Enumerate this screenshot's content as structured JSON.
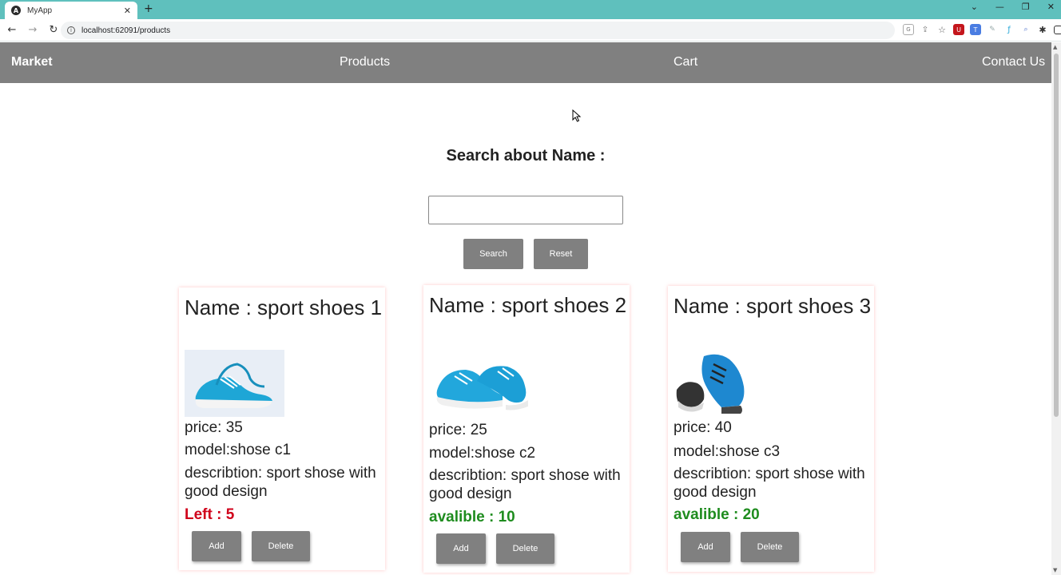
{
  "browser": {
    "tab_title": "MyApp",
    "tab_close": "✕",
    "new_tab": "+",
    "url": "localhost:62091/products",
    "win_controls": [
      "⌄",
      "—",
      "❐",
      "✕"
    ]
  },
  "navbar": {
    "brand": "Market",
    "links": [
      "Products",
      "Cart",
      "Contact Us"
    ]
  },
  "search": {
    "title": "Search about Name :",
    "input_value": "",
    "search_button": "Search",
    "reset_button": "Reset"
  },
  "products": [
    {
      "name": "Name : sport shoes 1",
      "price": "price: 35",
      "model": "model:shose c1",
      "description": "describtion: sport shose with good design",
      "stock": "Left : 5",
      "stock_color": "#d0021b",
      "image_icon": "shoe-image-icon",
      "add_label": "Add",
      "delete_label": "Delete"
    },
    {
      "name": "Name : sport shoes 2",
      "price": "price: 25",
      "model": "model:shose c2",
      "description": "describtion: sport shose with good design",
      "stock": "avalible : 10",
      "stock_color": "#1e8c1e",
      "image_icon": "shoe-image-icon",
      "add_label": "Add",
      "delete_label": "Delete"
    },
    {
      "name": "Name : sport shoes 3",
      "price": "price: 40",
      "model": "model:shose c3",
      "description": "describtion: sport shose with good design",
      "stock": "avalible : 20",
      "stock_color": "#1e8c1e",
      "image_icon": "shoe-image-icon",
      "add_label": "Add",
      "delete_label": "Delete"
    }
  ],
  "colors": {
    "tabbar": "#5fc0bd",
    "navbar": "#808080",
    "button": "#808080"
  }
}
